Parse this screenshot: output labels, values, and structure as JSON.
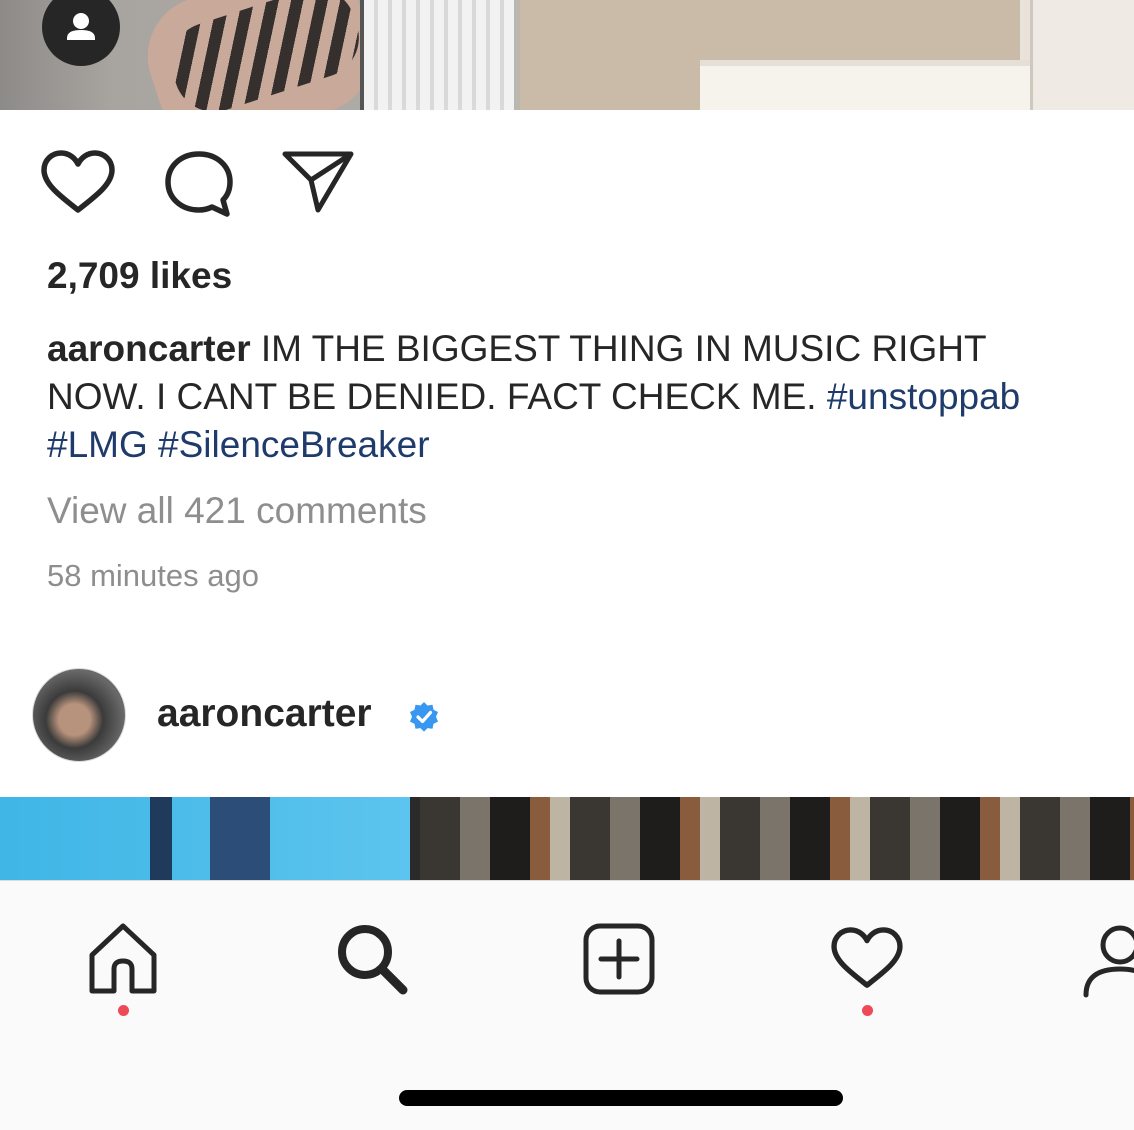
{
  "post": {
    "likes": "2,709 likes",
    "caption_user": "aaroncarter",
    "caption_text_line1": " IM THE BIGGEST THING IN MUSIC RIGHT",
    "caption_text_line2": "NOW. I CANT BE DENIED. FACT CHECK ME. ",
    "caption_tag1": "#unstoppab",
    "caption_tag2": "#LMG",
    "caption_tag3": "#SilenceBreaker",
    "view_comments": "View all 421 comments",
    "timestamp": "58 minutes ago"
  },
  "next_post": {
    "username": "aaroncarter",
    "verified": true
  },
  "actions": [
    "heart-icon",
    "comment-icon",
    "share-icon"
  ],
  "tabbar": {
    "items": [
      "home-icon",
      "search-icon",
      "add-post-icon",
      "activity-heart-icon",
      "profile-icon"
    ],
    "notification_dot_color": "#ed4956"
  },
  "colors": {
    "text": "#262626",
    "muted": "#8e8e8e",
    "hashtag": "#1f3b6b",
    "verified": "#3897f0"
  }
}
